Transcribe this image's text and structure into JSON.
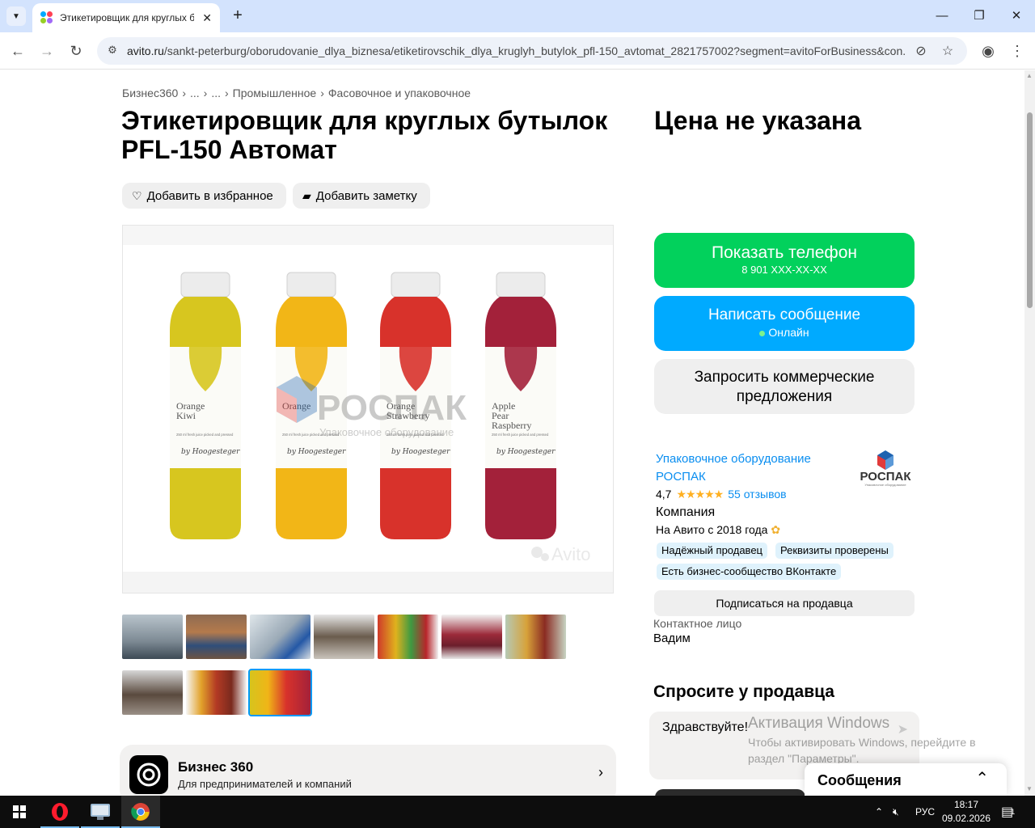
{
  "browser": {
    "tab_title": "Этикетировщик для круглых б",
    "tab_close": "✕",
    "new_tab": "+",
    "url_host": "avito.ru",
    "url_path": "/sankt-peterburg/oborudovanie_dlya_biznesa/etiketirovschik_dlya_kruglyh_butylok_pfl-150_avtomat_2821757002?segment=avitoForBusiness&con..."
  },
  "breadcrumb": [
    "Бизнес360",
    "›",
    "...",
    "›",
    "...",
    "›",
    "Промышленное",
    "›",
    "Фасовочное и упаковочное"
  ],
  "listing": {
    "title": "Этикетировщик для круглых бутылок PFL-150 Автомат",
    "price": "Цена не указана",
    "favorite_label": "Добавить в избранное",
    "note_label": "Добавить заметку"
  },
  "photo": {
    "bottles": [
      {
        "name": "Orange\nKiwi",
        "color": "#d7c61f"
      },
      {
        "name": "Orange",
        "color": "#f2b617"
      },
      {
        "name": "Orange\nStrawberry",
        "color": "#d8322b"
      },
      {
        "name": "Apple\nPear\nRaspberry",
        "color": "#a3213a"
      }
    ],
    "watermark_brand": "РОСПАК",
    "watermark_sub": "Упаковочное оборудование",
    "avito_mark": "Avito",
    "bottle_sub": "250 ml fresh juice picked and pressed",
    "signature": "by Hoogesteger"
  },
  "business_card": {
    "title": "Бизнес 360",
    "subtitle": "Для предпринимателей и компаний"
  },
  "actions": {
    "phone_label": "Показать телефон",
    "phone_number": "8 901 XXX-XX-XX",
    "message_label": "Написать сообщение",
    "message_status": "Онлайн",
    "offers_label": "Запросить коммерческие предложения"
  },
  "seller": {
    "name": "Упаковочное оборудование РОСПАК",
    "rating": "4,7",
    "stars": "★★★★★",
    "reviews": "55 отзывов",
    "type": "Компания",
    "since": "На Авито с 2018 года",
    "badges": [
      "Надёжный продавец",
      "Реквизиты проверены",
      "Есть бизнес-сообщество ВКонтакте"
    ],
    "subscribe_label": "Подписаться на продавца",
    "contact_label": "Контактное лицо",
    "contact_name": "Вадим",
    "logo_text": "РОСПАК",
    "logo_sub": "Упаковочное оборудование"
  },
  "ask": {
    "heading": "Спросите у продавца",
    "draft": "Здравствуйте!"
  },
  "messages_panel": {
    "title": "Сообщения"
  },
  "activation": {
    "line1": "Активация Windows",
    "line2": "Чтобы активировать Windows, перейдите в раздел \"Параметры\"."
  },
  "taskbar": {
    "lang": "РУС",
    "time": "18:17",
    "date": "09.02.2026",
    "notif_count": "1"
  }
}
